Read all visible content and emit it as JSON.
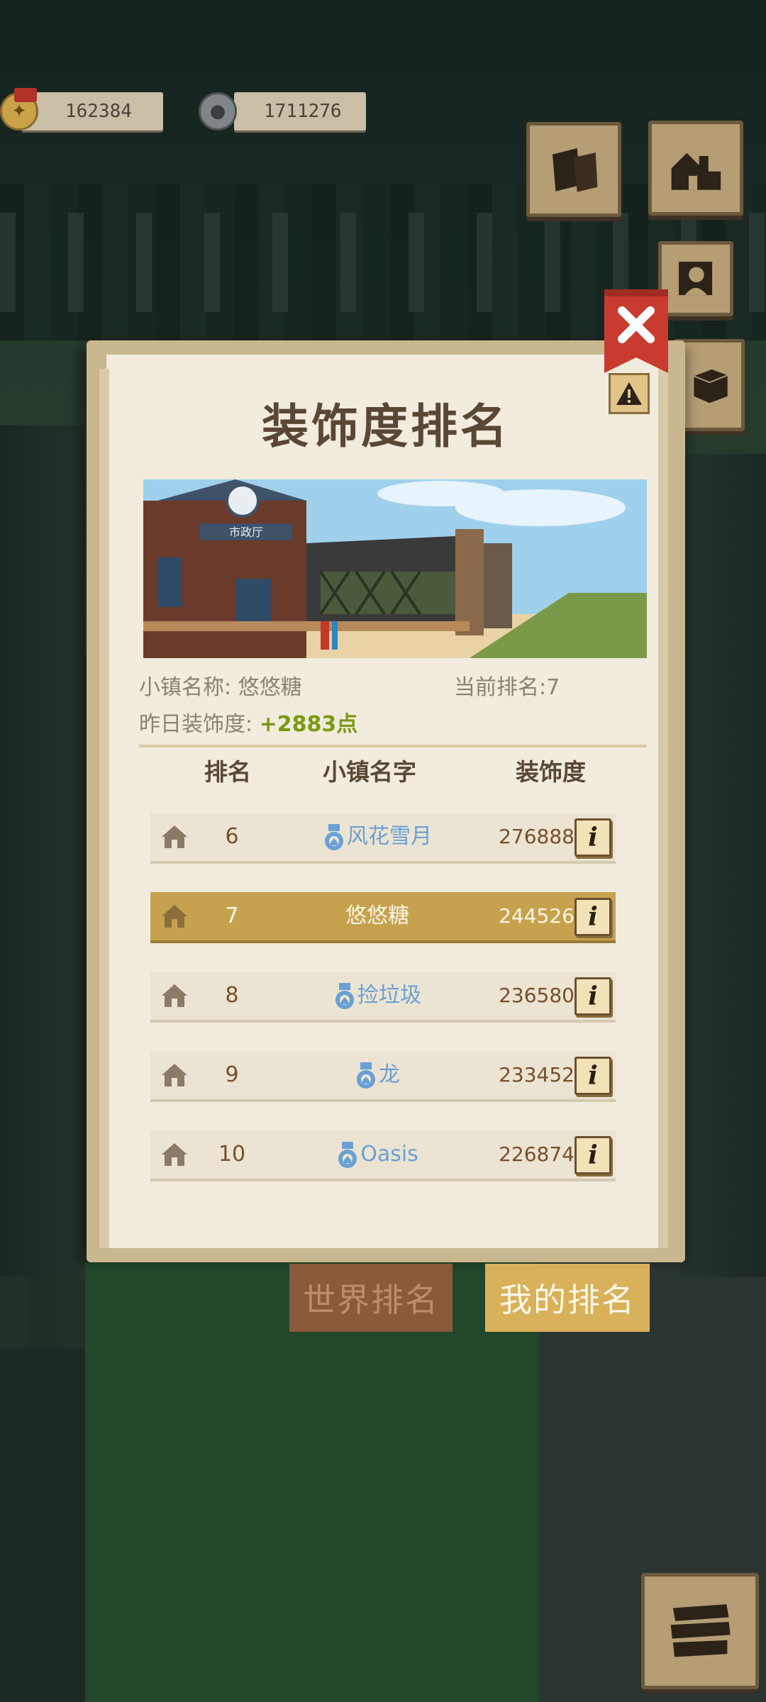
{
  "hud": {
    "gold_value": "162384",
    "stone_value": "1711276"
  },
  "side_buttons": {
    "scroll_icon": "scroll-icon",
    "house_icon": "house-icon",
    "portrait_icon": "portrait-icon",
    "box_icon": "box-icon",
    "menu_icon": "stack-menu-icon"
  },
  "modal": {
    "title": "装饰度排名",
    "town_name_label": "小镇名称: 悠悠糖",
    "current_rank_label": "当前排名:7",
    "yesterday_label": "昨日装饰度: ",
    "yesterday_value": "+2883点",
    "columns": {
      "rank": "排名",
      "name": "小镇名字",
      "deco": "装饰度"
    },
    "rows": [
      {
        "rank": "6",
        "name": "风花雪月",
        "score": "276888",
        "mine": false,
        "badge": true
      },
      {
        "rank": "7",
        "name": "悠悠糖",
        "score": "244526",
        "mine": true,
        "badge": false
      },
      {
        "rank": "8",
        "name": "捡垃圾",
        "score": "236580",
        "mine": false,
        "badge": true
      },
      {
        "rank": "9",
        "name": "龙",
        "score": "233452",
        "mine": false,
        "badge": true
      },
      {
        "rank": "10",
        "name": "Oasis",
        "score": "226874",
        "mine": false,
        "badge": true
      }
    ],
    "info_glyph": "i",
    "banner_sign": "市政厅"
  },
  "tabs": {
    "world": "世界排名",
    "mine": "我的排名"
  },
  "colors": {
    "paper": "#f1ecdd",
    "title": "#5a4734",
    "highlight_row": "#c7a24e",
    "positive": "#7a9a12",
    "player_name": "#6aa0d6",
    "close": "#c83b2e"
  }
}
